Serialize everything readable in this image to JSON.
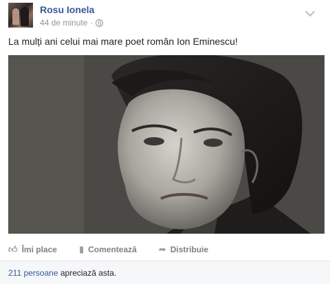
{
  "post": {
    "author": "Rosu Ionela",
    "time": "44 de minute",
    "separator": "·",
    "text": "La mulți ani celui mai mare poet român Ion Eminescu!"
  },
  "actions": {
    "like_label": "Îmi place",
    "comment_label": "Comentează",
    "share_label": "Distribuie"
  },
  "likes": {
    "count_text": "211 persoane",
    "suffix_text": "apreciază asta."
  },
  "icons": {
    "like": "thumbs-up-icon",
    "comment": "comment-icon",
    "share": "share-arrow-icon",
    "privacy": "globe-icon",
    "menu": "chevron-down-icon"
  },
  "colors": {
    "author_link": "#365899",
    "meta_text": "#90949c",
    "action_text": "#7f7f7f",
    "likes_bar": "#f6f7f9"
  }
}
